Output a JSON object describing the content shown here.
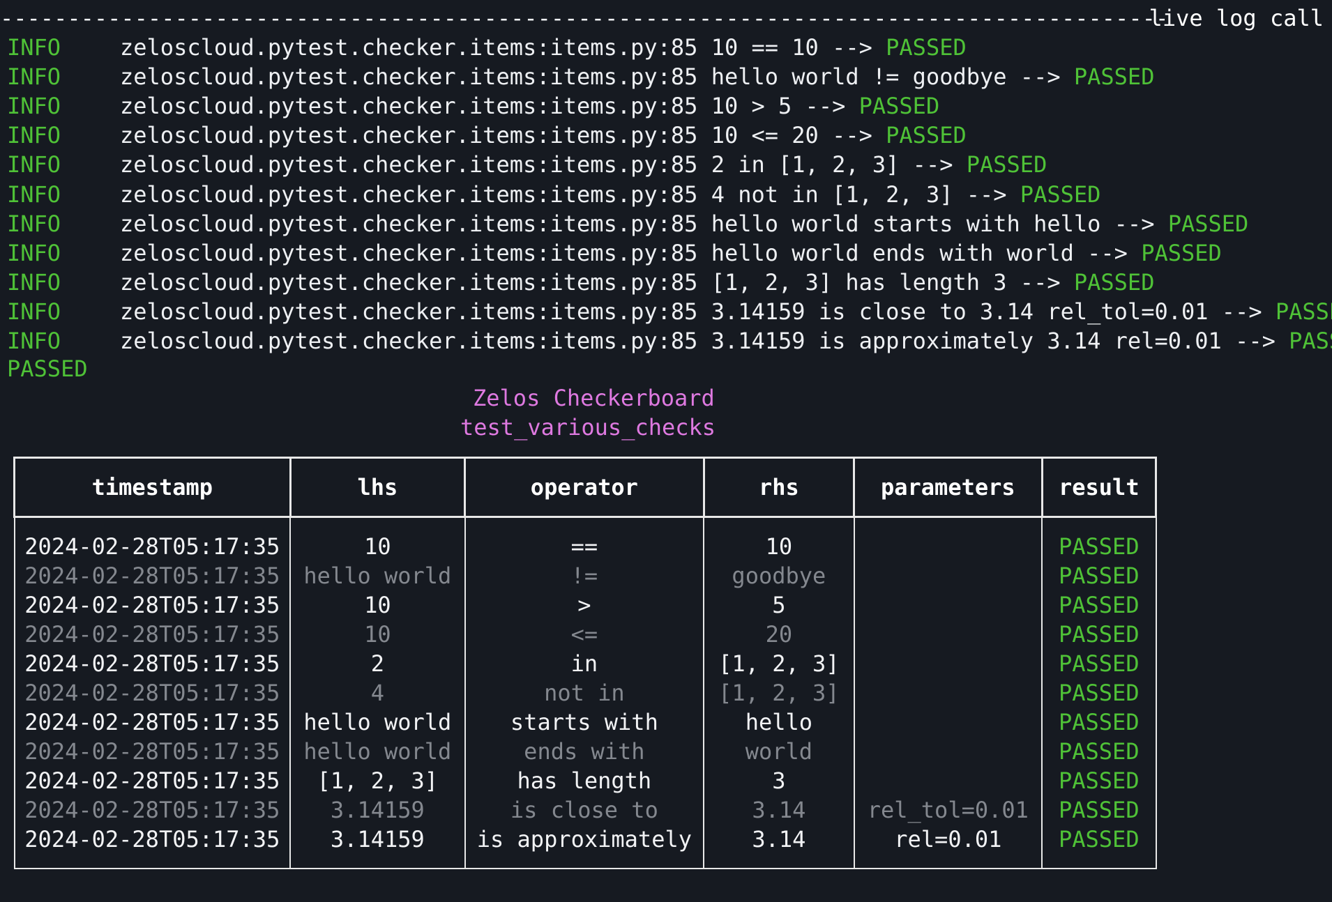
{
  "header": {
    "dashes": "--------------------------------------------------------------------------------------------------",
    "label": "live log call"
  },
  "log": [
    {
      "level": "INFO",
      "source": "zeloscloud.pytest.checker.items:items.py:85",
      "message": "10 == 10 --> ",
      "status": "PASSED"
    },
    {
      "level": "INFO",
      "source": "zeloscloud.pytest.checker.items:items.py:85",
      "message": "hello world != goodbye --> ",
      "status": "PASSED"
    },
    {
      "level": "INFO",
      "source": "zeloscloud.pytest.checker.items:items.py:85",
      "message": "10 > 5 --> ",
      "status": "PASSED"
    },
    {
      "level": "INFO",
      "source": "zeloscloud.pytest.checker.items:items.py:85",
      "message": "10 <= 20 --> ",
      "status": "PASSED"
    },
    {
      "level": "INFO",
      "source": "zeloscloud.pytest.checker.items:items.py:85",
      "message": "2 in [1, 2, 3] --> ",
      "status": "PASSED"
    },
    {
      "level": "INFO",
      "source": "zeloscloud.pytest.checker.items:items.py:85",
      "message": "4 not in [1, 2, 3] --> ",
      "status": "PASSED"
    },
    {
      "level": "INFO",
      "source": "zeloscloud.pytest.checker.items:items.py:85",
      "message": "hello world starts with hello --> ",
      "status": "PASSED"
    },
    {
      "level": "INFO",
      "source": "zeloscloud.pytest.checker.items:items.py:85",
      "message": "hello world ends with world --> ",
      "status": "PASSED"
    },
    {
      "level": "INFO",
      "source": "zeloscloud.pytest.checker.items:items.py:85",
      "message": "[1, 2, 3] has length 3 --> ",
      "status": "PASSED"
    },
    {
      "level": "INFO",
      "source": "zeloscloud.pytest.checker.items:items.py:85",
      "message": "3.14159 is close to 3.14 rel_tol=0.01 --> ",
      "status": "PASSED"
    },
    {
      "level": "INFO",
      "source": "zeloscloud.pytest.checker.items:items.py:85",
      "message": "3.14159 is approximately 3.14 rel=0.01 --> ",
      "status": "PASSED"
    }
  ],
  "overall_status": "PASSED",
  "board": {
    "title": "Zelos Checkerboard",
    "test_name": "test_various_checks",
    "columns": [
      "timestamp",
      "lhs",
      "operator",
      "rhs",
      "parameters",
      "result"
    ],
    "rows": [
      [
        "2024-02-28T05:17:35",
        "10",
        "==",
        "10",
        "",
        "PASSED"
      ],
      [
        "2024-02-28T05:17:35",
        "hello world",
        "!=",
        "goodbye",
        "",
        "PASSED"
      ],
      [
        "2024-02-28T05:17:35",
        "10",
        ">",
        "5",
        "",
        "PASSED"
      ],
      [
        "2024-02-28T05:17:35",
        "10",
        "<=",
        "20",
        "",
        "PASSED"
      ],
      [
        "2024-02-28T05:17:35",
        "2",
        "in",
        "[1, 2, 3]",
        "",
        "PASSED"
      ],
      [
        "2024-02-28T05:17:35",
        "4",
        "not in",
        "[1, 2, 3]",
        "",
        "PASSED"
      ],
      [
        "2024-02-28T05:17:35",
        "hello world",
        "starts with",
        "hello",
        "",
        "PASSED"
      ],
      [
        "2024-02-28T05:17:35",
        "hello world",
        "ends with",
        "world",
        "",
        "PASSED"
      ],
      [
        "2024-02-28T05:17:35",
        "[1, 2, 3]",
        "has length",
        "3",
        "",
        "PASSED"
      ],
      [
        "2024-02-28T05:17:35",
        "3.14159",
        "is close to",
        "3.14",
        "rel_tol=0.01",
        "PASSED"
      ],
      [
        "2024-02-28T05:17:35",
        "3.14159",
        "is approximately",
        "3.14",
        "rel=0.01",
        "PASSED"
      ]
    ]
  },
  "colors": {
    "background": "#161a21",
    "text": "#eef0f3",
    "dim_text": "#84888f",
    "pass_green": "#4fc237",
    "title_magenta": "#de79e0",
    "border": "#e8e8e8"
  }
}
